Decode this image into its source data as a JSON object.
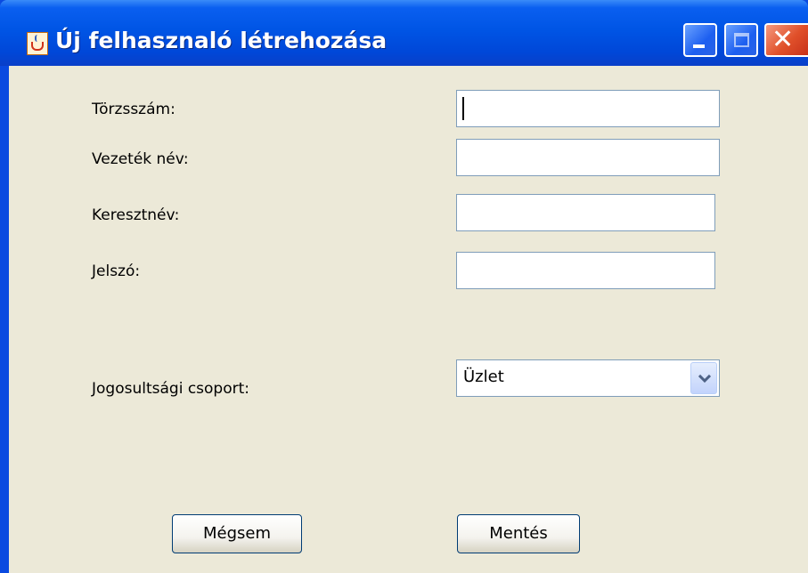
{
  "window": {
    "title": "Új felhasznaló létrehozása",
    "icon": "java-cup-icon",
    "controls": {
      "minimize": "minimize-icon",
      "maximize": "maximize-icon",
      "close": "close-icon"
    }
  },
  "form": {
    "torzsszam": {
      "label": "Törzsszám:",
      "value": ""
    },
    "vezeteknev": {
      "label": "Vezeték név:",
      "value": ""
    },
    "keresztnev": {
      "label": "Keresztnév:",
      "value": ""
    },
    "jelszo": {
      "label": "Jelszó:",
      "value": ""
    },
    "csoport": {
      "label": "Jogosultsági csoport:",
      "selected": "Üzlet"
    }
  },
  "buttons": {
    "cancel": "Mégsem",
    "save": "Mentés"
  },
  "colors": {
    "titlebar": "#0055e5",
    "client": "#ece9d8",
    "field_border": "#7f9db9"
  }
}
